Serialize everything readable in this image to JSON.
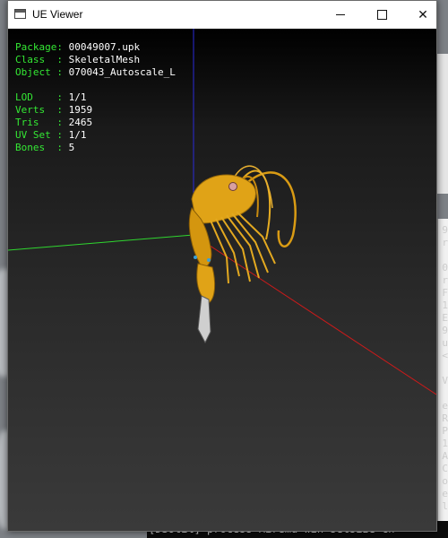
{
  "window": {
    "title": "UE Viewer",
    "minimize_icon": "minimize-icon",
    "maximize_icon": "maximize-icon",
    "close_icon": "close-icon",
    "close_label": "✕"
  },
  "info": {
    "lines1": [
      {
        "key": "Package",
        "value": "00049007.upk"
      },
      {
        "key": "Class  ",
        "value": "SkeletalMesh"
      },
      {
        "key": "Object ",
        "value": "070043_Autoscale_L"
      }
    ],
    "lines2": [
      {
        "key": "LOD    ",
        "value": "1/1"
      },
      {
        "key": "Verts  ",
        "value": "1959"
      },
      {
        "key": "Tris   ",
        "value": "2465"
      },
      {
        "key": "UV Set ",
        "value": "1/1"
      },
      {
        "key": "Bones  ",
        "value": "5"
      }
    ]
  },
  "console": {
    "status_line": "[DSUtil] process  Miremu win setsize  cn",
    "right_chars": [
      "9",
      "r",
      "",
      "0",
      "r",
      "F",
      "1",
      "E",
      "9",
      "u",
      "<",
      "",
      "V",
      "",
      "e",
      "R",
      "P",
      "1",
      "A",
      "C",
      "o",
      "e",
      "l"
    ]
  },
  "colors": {
    "label_green": "#34e834",
    "value_white": "#ffffff",
    "axis_x": "#cc1a1a",
    "axis_y": "#2fd62f",
    "axis_z": "#2a2ad8",
    "mesh_gold": "#e0a317"
  }
}
